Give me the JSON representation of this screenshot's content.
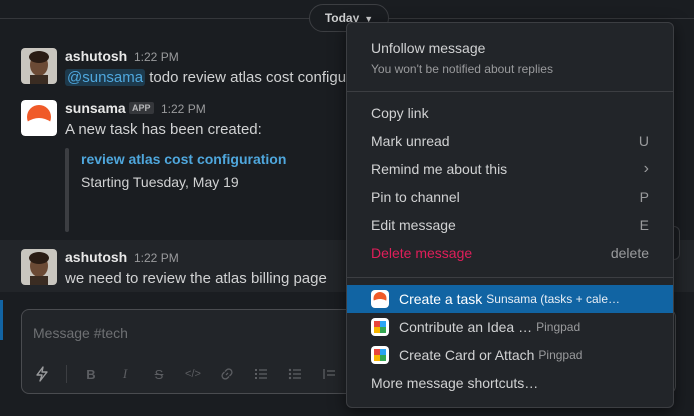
{
  "date_divider": {
    "label": "Today",
    "chevron": "chevron-down-icon"
  },
  "messages": [
    {
      "sender": "ashutosh",
      "time": "1:22 PM",
      "mention": "@sunsama",
      "text": "todo review atlas cost configura"
    },
    {
      "sender": "sunsama",
      "badge": "APP",
      "time": "1:22 PM",
      "text": "A new task has been created:",
      "task_title": "review atlas cost configuration",
      "task_date": "Starting Tuesday, May 19"
    },
    {
      "sender": "ashutosh",
      "time": "1:22 PM",
      "text": "we need to review the atlas billing page"
    }
  ],
  "action_bar": {
    "more_icon": "more-vertical-icon",
    "glyph": "⋮"
  },
  "composer": {
    "placeholder": "Message #tech",
    "toolbar_icons": [
      "lightning-icon",
      "bold-icon",
      "italic-icon",
      "strikethrough-icon",
      "code-icon",
      "link-icon",
      "ordered-list-icon",
      "bullet-list-icon",
      "blockquote-icon"
    ],
    "attach_icon": "paperclip-icon"
  },
  "context_menu": {
    "unfollow": {
      "label": "Unfollow message",
      "sub": "You won't be notified about replies"
    },
    "items": [
      {
        "label": "Copy link",
        "shortcut": ""
      },
      {
        "label": "Mark unread",
        "shortcut": "U"
      },
      {
        "label": "Remind me about this",
        "shortcut": "›"
      },
      {
        "label": "Pin to channel",
        "shortcut": "P"
      },
      {
        "label": "Edit message",
        "shortcut": "E"
      },
      {
        "label": "Delete message",
        "shortcut": "delete"
      }
    ],
    "shortcuts": [
      {
        "label": "Create a task",
        "app": "Sunsama (tasks + cale…",
        "icon": "sunsama-icon"
      },
      {
        "label": "Contribute an Idea …",
        "app": "Pingpad",
        "icon": "pingpad-icon"
      },
      {
        "label": "Create Card or Attach",
        "app": "Pingpad",
        "icon": "pingpad-icon"
      }
    ],
    "more": "More message shortcuts…"
  },
  "colors": {
    "accent": "#1164a3",
    "danger": "#e01e5a",
    "link": "#4fa7dd",
    "sunsama": "#f05a28"
  }
}
